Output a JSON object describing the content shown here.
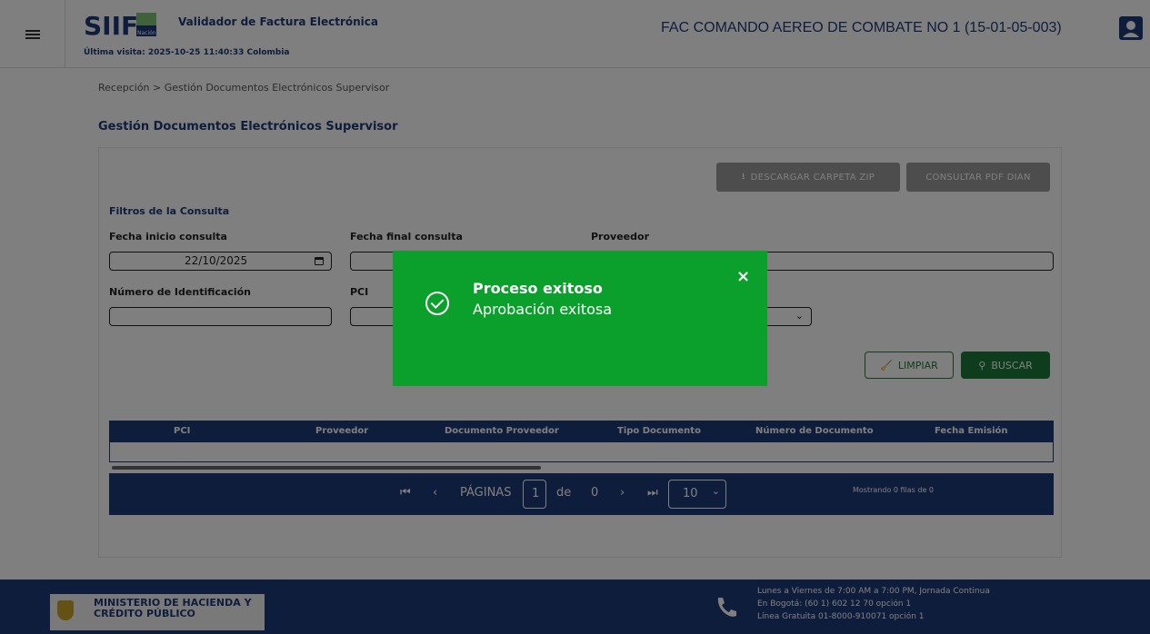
{
  "header": {
    "app_title": "Validador de Factura Electrónica",
    "last_visit": "Última visita: 2025-10-25 11:40:33 Colombia",
    "entity": "FAC COMANDO AEREO DE COMBATE NO 1 (15-01-05-003)",
    "logo": "SIIF Nación"
  },
  "breadcrumb": {
    "root": "Recepción",
    "separator": ">",
    "current": "Gestión Documentos Electrónicos Supervisor"
  },
  "page_title": "Gestión Documentos Electrónicos Supervisor",
  "actions": {
    "download_zip": "DESCARGAR CARPETA ZIP",
    "consult_pdf": "CONSULTAR PDF DIAN"
  },
  "filters": {
    "section_title": "Filtros de la Consulta",
    "start_date_label": "Fecha inicio consulta",
    "start_date_value": "22/10/2025",
    "end_date_label": "Fecha final consulta",
    "supplier_label": "Proveedor",
    "id_number_label": "Número de Identificación",
    "pci_label": "PCI"
  },
  "buttons": {
    "clear": "LIMPIAR",
    "search": "BUSCAR"
  },
  "table": {
    "columns": [
      "PCI",
      "Proveedor",
      "Documento Proveedor",
      "Tipo Documento",
      "Número de Documento",
      "Fecha Emisión"
    ]
  },
  "pager": {
    "pages_label": "PÁGINAS",
    "current_page": "1",
    "of_label": "de",
    "total_pages": "0",
    "page_size": "10",
    "showing": "Mostrando 0 filas de 0"
  },
  "footer": {
    "ministry": "MINISTERIO DE HACIENDA Y CRÉDITO PÚBLICO",
    "hours": "Lunes a Viernes de 7:00 AM a 7:00 PM, Jornada Continua",
    "bogota": "En Bogotá: (60 1) 602 12 70 opción 1",
    "toll_free": "Línea Gratuita 01-8000-910071 opción 1"
  },
  "toast": {
    "title": "Proceso exitoso",
    "message": "Aprobación exitosa",
    "close": "×"
  },
  "colors": {
    "primary": "#1f3a78",
    "success": "#0aa02b",
    "button_green": "#1d7b3a"
  }
}
